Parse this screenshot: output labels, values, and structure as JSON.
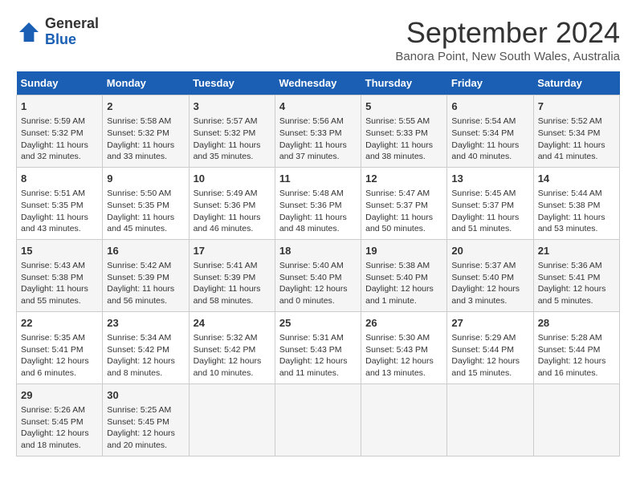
{
  "header": {
    "logo": {
      "line1": "General",
      "line2": "Blue"
    },
    "title": "September 2024",
    "location": "Banora Point, New South Wales, Australia"
  },
  "weekdays": [
    "Sunday",
    "Monday",
    "Tuesday",
    "Wednesday",
    "Thursday",
    "Friday",
    "Saturday"
  ],
  "weeks": [
    [
      {
        "day": "1",
        "sunrise": "Sunrise: 5:59 AM",
        "sunset": "Sunset: 5:32 PM",
        "daylight": "Daylight: 11 hours and 32 minutes."
      },
      {
        "day": "2",
        "sunrise": "Sunrise: 5:58 AM",
        "sunset": "Sunset: 5:32 PM",
        "daylight": "Daylight: 11 hours and 33 minutes."
      },
      {
        "day": "3",
        "sunrise": "Sunrise: 5:57 AM",
        "sunset": "Sunset: 5:32 PM",
        "daylight": "Daylight: 11 hours and 35 minutes."
      },
      {
        "day": "4",
        "sunrise": "Sunrise: 5:56 AM",
        "sunset": "Sunset: 5:33 PM",
        "daylight": "Daylight: 11 hours and 37 minutes."
      },
      {
        "day": "5",
        "sunrise": "Sunrise: 5:55 AM",
        "sunset": "Sunset: 5:33 PM",
        "daylight": "Daylight: 11 hours and 38 minutes."
      },
      {
        "day": "6",
        "sunrise": "Sunrise: 5:54 AM",
        "sunset": "Sunset: 5:34 PM",
        "daylight": "Daylight: 11 hours and 40 minutes."
      },
      {
        "day": "7",
        "sunrise": "Sunrise: 5:52 AM",
        "sunset": "Sunset: 5:34 PM",
        "daylight": "Daylight: 11 hours and 41 minutes."
      }
    ],
    [
      {
        "day": "8",
        "sunrise": "Sunrise: 5:51 AM",
        "sunset": "Sunset: 5:35 PM",
        "daylight": "Daylight: 11 hours and 43 minutes."
      },
      {
        "day": "9",
        "sunrise": "Sunrise: 5:50 AM",
        "sunset": "Sunset: 5:35 PM",
        "daylight": "Daylight: 11 hours and 45 minutes."
      },
      {
        "day": "10",
        "sunrise": "Sunrise: 5:49 AM",
        "sunset": "Sunset: 5:36 PM",
        "daylight": "Daylight: 11 hours and 46 minutes."
      },
      {
        "day": "11",
        "sunrise": "Sunrise: 5:48 AM",
        "sunset": "Sunset: 5:36 PM",
        "daylight": "Daylight: 11 hours and 48 minutes."
      },
      {
        "day": "12",
        "sunrise": "Sunrise: 5:47 AM",
        "sunset": "Sunset: 5:37 PM",
        "daylight": "Daylight: 11 hours and 50 minutes."
      },
      {
        "day": "13",
        "sunrise": "Sunrise: 5:45 AM",
        "sunset": "Sunset: 5:37 PM",
        "daylight": "Daylight: 11 hours and 51 minutes."
      },
      {
        "day": "14",
        "sunrise": "Sunrise: 5:44 AM",
        "sunset": "Sunset: 5:38 PM",
        "daylight": "Daylight: 11 hours and 53 minutes."
      }
    ],
    [
      {
        "day": "15",
        "sunrise": "Sunrise: 5:43 AM",
        "sunset": "Sunset: 5:38 PM",
        "daylight": "Daylight: 11 hours and 55 minutes."
      },
      {
        "day": "16",
        "sunrise": "Sunrise: 5:42 AM",
        "sunset": "Sunset: 5:39 PM",
        "daylight": "Daylight: 11 hours and 56 minutes."
      },
      {
        "day": "17",
        "sunrise": "Sunrise: 5:41 AM",
        "sunset": "Sunset: 5:39 PM",
        "daylight": "Daylight: 11 hours and 58 minutes."
      },
      {
        "day": "18",
        "sunrise": "Sunrise: 5:40 AM",
        "sunset": "Sunset: 5:40 PM",
        "daylight": "Daylight: 12 hours and 0 minutes."
      },
      {
        "day": "19",
        "sunrise": "Sunrise: 5:38 AM",
        "sunset": "Sunset: 5:40 PM",
        "daylight": "Daylight: 12 hours and 1 minute."
      },
      {
        "day": "20",
        "sunrise": "Sunrise: 5:37 AM",
        "sunset": "Sunset: 5:40 PM",
        "daylight": "Daylight: 12 hours and 3 minutes."
      },
      {
        "day": "21",
        "sunrise": "Sunrise: 5:36 AM",
        "sunset": "Sunset: 5:41 PM",
        "daylight": "Daylight: 12 hours and 5 minutes."
      }
    ],
    [
      {
        "day": "22",
        "sunrise": "Sunrise: 5:35 AM",
        "sunset": "Sunset: 5:41 PM",
        "daylight": "Daylight: 12 hours and 6 minutes."
      },
      {
        "day": "23",
        "sunrise": "Sunrise: 5:34 AM",
        "sunset": "Sunset: 5:42 PM",
        "daylight": "Daylight: 12 hours and 8 minutes."
      },
      {
        "day": "24",
        "sunrise": "Sunrise: 5:32 AM",
        "sunset": "Sunset: 5:42 PM",
        "daylight": "Daylight: 12 hours and 10 minutes."
      },
      {
        "day": "25",
        "sunrise": "Sunrise: 5:31 AM",
        "sunset": "Sunset: 5:43 PM",
        "daylight": "Daylight: 12 hours and 11 minutes."
      },
      {
        "day": "26",
        "sunrise": "Sunrise: 5:30 AM",
        "sunset": "Sunset: 5:43 PM",
        "daylight": "Daylight: 12 hours and 13 minutes."
      },
      {
        "day": "27",
        "sunrise": "Sunrise: 5:29 AM",
        "sunset": "Sunset: 5:44 PM",
        "daylight": "Daylight: 12 hours and 15 minutes."
      },
      {
        "day": "28",
        "sunrise": "Sunrise: 5:28 AM",
        "sunset": "Sunset: 5:44 PM",
        "daylight": "Daylight: 12 hours and 16 minutes."
      }
    ],
    [
      {
        "day": "29",
        "sunrise": "Sunrise: 5:26 AM",
        "sunset": "Sunset: 5:45 PM",
        "daylight": "Daylight: 12 hours and 18 minutes."
      },
      {
        "day": "30",
        "sunrise": "Sunrise: 5:25 AM",
        "sunset": "Sunset: 5:45 PM",
        "daylight": "Daylight: 12 hours and 20 minutes."
      },
      null,
      null,
      null,
      null,
      null
    ]
  ]
}
